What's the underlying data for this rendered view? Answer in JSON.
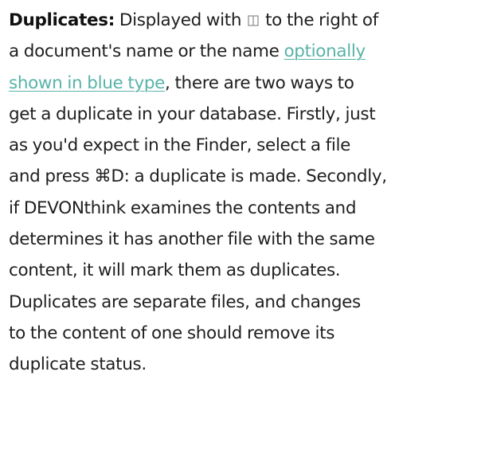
{
  "paragraph": {
    "term": "Duplicates:",
    "line1_after_term": " Displayed with",
    "line1_after_icon": " to the right of",
    "line2_before_link": "a document's name or the name ",
    "link_part1": "optionally",
    "link_part2": "shown in blue type",
    "line3_after_link": ", there are two ways to",
    "line4": "get a duplicate in your database. Firstly, just",
    "line5": "as you'd expect in the Finder, select a file",
    "line6": "and press ⌘D: a duplicate is made. Secondly,",
    "line7": "if DEVONthink examines the contents and",
    "line8": "determines it has another file with the same",
    "line9": "content, it will mark them as duplicates.",
    "line10": "Duplicates are separate files, and changes",
    "line11": "to the content of one should remove its",
    "line12": "duplicate status."
  },
  "icons": {
    "duplicate": "duplicate-icon"
  },
  "colors": {
    "link": "#58b3a8",
    "text": "#1f1f1f"
  }
}
